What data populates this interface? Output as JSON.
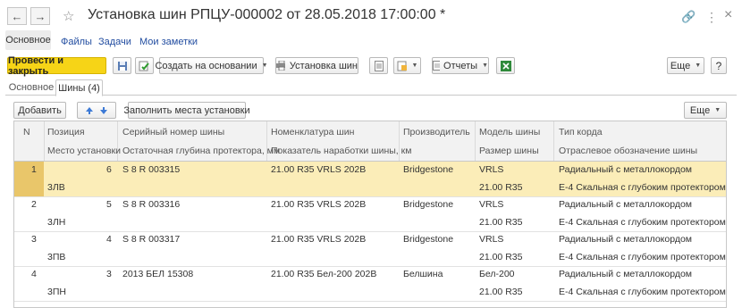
{
  "window": {
    "title": "Установка шин РПЦУ-000002 от 28.05.2018 17:00:00 *",
    "nav_back": "←",
    "nav_forward": "→",
    "star": "☆",
    "link_icon": "🔗",
    "more_icon": "⋮",
    "close": "×"
  },
  "page_tabs": {
    "main": "Основное",
    "files": "Файлы",
    "tasks": "Задачи",
    "notes": "Мои заметки"
  },
  "toolbar": {
    "post_close": "Провести и закрыть",
    "create_based": "Создать на основании",
    "tire_install": "Установка шин",
    "reports": "Отчеты",
    "more": "Еще"
  },
  "form_tabs": {
    "main": "Основное",
    "tires": "Шины (4)"
  },
  "table_toolbar": {
    "add": "Добавить",
    "fill": "Заполнить места установки",
    "more": "Еще"
  },
  "columns": {
    "n": "N",
    "pos": "Позиция",
    "place": "Место установки",
    "serial": "Серийный номер шины",
    "depth": "Остаточная глубина протектора, мм",
    "nomen": "Номенклатура шин",
    "mileage": "Показатель наработки шины, км",
    "maker": "Производитель",
    "model": "Модель шины",
    "size": "Размер шины",
    "cord": "Тип корда",
    "industry": "Отраслевое обозначение шины"
  },
  "rows": [
    {
      "n": "1",
      "pos": "6",
      "place": "3ЛВ",
      "serial": "S 8 R 003315",
      "nomen": "21.00 R35  VRLS  202B",
      "maker": "Bridgestone",
      "model": "VRLS",
      "size": "21.00 R35",
      "cord": "Радиальный с металлокордом",
      "industry": "E-4 Скальная с глубоким протектором"
    },
    {
      "n": "2",
      "pos": "5",
      "place": "3ЛН",
      "serial": "S 8 R 003316",
      "nomen": "21.00 R35  VRLS  202B",
      "maker": "Bridgestone",
      "model": "VRLS",
      "size": "21.00 R35",
      "cord": "Радиальный с металлокордом",
      "industry": "E-4 Скальная с глубоким протектором"
    },
    {
      "n": "3",
      "pos": "4",
      "place": "3ПВ",
      "serial": "S 8 R 003317",
      "nomen": "21.00 R35  VRLS  202B",
      "maker": "Bridgestone",
      "model": "VRLS",
      "size": "21.00 R35",
      "cord": "Радиальный с металлокордом",
      "industry": "E-4 Скальная с глубоким протектором"
    },
    {
      "n": "4",
      "pos": "3",
      "place": "3ПН",
      "serial": "2013 БЕЛ 15308",
      "nomen": "21.00 R35  Бел-200  202B",
      "maker": "Белшина",
      "model": "Бел-200",
      "size": "21.00 R35",
      "cord": "Радиальный с металлокордом",
      "industry": "E-4 Скальная с глубоким протектором"
    }
  ]
}
